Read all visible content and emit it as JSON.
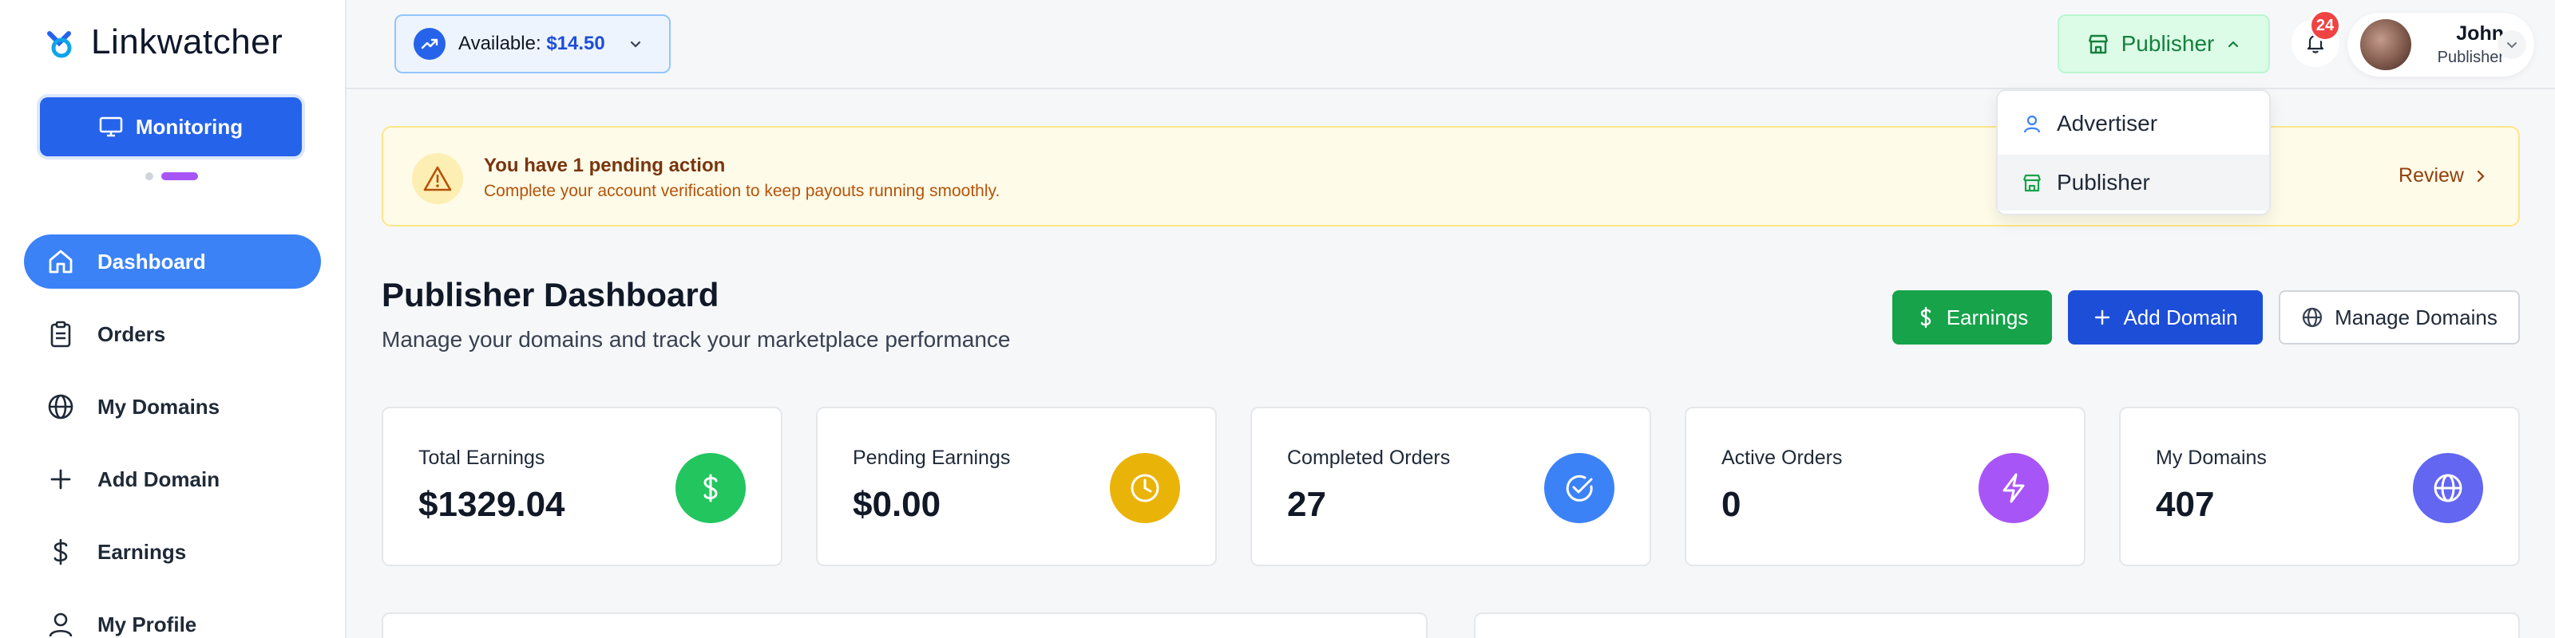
{
  "brand": {
    "name": "Linkwatcher"
  },
  "sidebar": {
    "monitoring_label": "Monitoring",
    "items": [
      {
        "label": "Dashboard",
        "icon": "home-icon",
        "active": true
      },
      {
        "label": "Orders",
        "icon": "clipboard-icon"
      },
      {
        "label": "My Domains",
        "icon": "globe-icon"
      },
      {
        "label": "Add Domain",
        "icon": "plus-icon"
      },
      {
        "label": "Earnings",
        "icon": "dollar-icon"
      },
      {
        "label": "My Profile",
        "icon": "user-icon"
      }
    ]
  },
  "topbar": {
    "balance_label": "Available:",
    "balance_amount": "$14.50",
    "role_label": "Publisher",
    "notification_count": "24",
    "user_name": "John",
    "user_role": "Publisher"
  },
  "role_dropdown": {
    "options": [
      {
        "label": "Advertiser",
        "icon": "user-icon"
      },
      {
        "label": "Publisher",
        "icon": "store-icon",
        "selected": true
      }
    ]
  },
  "alert": {
    "title": "You have 1 pending action",
    "message": "Complete your account verification to keep payouts running smoothly.",
    "action_label": "Review"
  },
  "page": {
    "title": "Publisher Dashboard",
    "subtitle": "Manage your domains and track your marketplace performance",
    "buttons": {
      "earnings": "Earnings",
      "add_domain": "Add Domain",
      "manage_domains": "Manage Domains"
    }
  },
  "stats": [
    {
      "label": "Total Earnings",
      "value": "$1329.04",
      "icon": "dollar-icon",
      "color": "#22c55e"
    },
    {
      "label": "Pending Earnings",
      "value": "$0.00",
      "icon": "clock-icon",
      "color": "#eab308"
    },
    {
      "label": "Completed Orders",
      "value": "27",
      "icon": "check-circle-icon",
      "color": "#3b82f6"
    },
    {
      "label": "Active Orders",
      "value": "0",
      "icon": "bolt-icon",
      "color": "#a855f7"
    },
    {
      "label": "My Domains",
      "value": "407",
      "icon": "globe-icon",
      "color": "#6366f1"
    }
  ],
  "colors": {
    "primary": "#2563eb",
    "success": "#16a34a",
    "warning_bg": "#fefbe8"
  }
}
